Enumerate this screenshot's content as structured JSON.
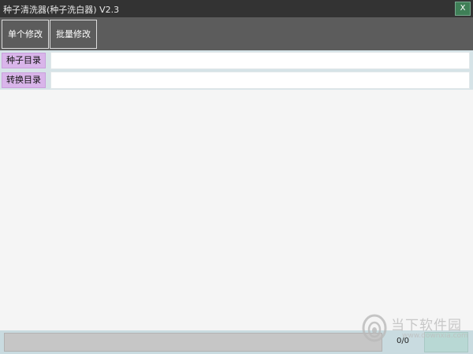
{
  "window": {
    "title": "种子清洗器(种子洗白器) V2.3",
    "close_label": "X"
  },
  "toolbar": {
    "single_edit_label": "单个修改",
    "batch_edit_label": "批量修改"
  },
  "fields": {
    "seed_dir_label": "种子目录",
    "seed_dir_value": "",
    "convert_dir_label": "转换目录",
    "convert_dir_value": ""
  },
  "status": {
    "progress_count": "0/0",
    "progress_fraction": 0
  },
  "watermark": {
    "text": "当下软件园",
    "sub": "www.downxia.com",
    "icon": "downxia-logo-icon"
  },
  "colors": {
    "titlebar": "#333333",
    "toolbar": "#5c5c5c",
    "close_button": "#3f7f57",
    "field_label": "#d9b5ea",
    "statusbar": "#c9dbe0"
  }
}
